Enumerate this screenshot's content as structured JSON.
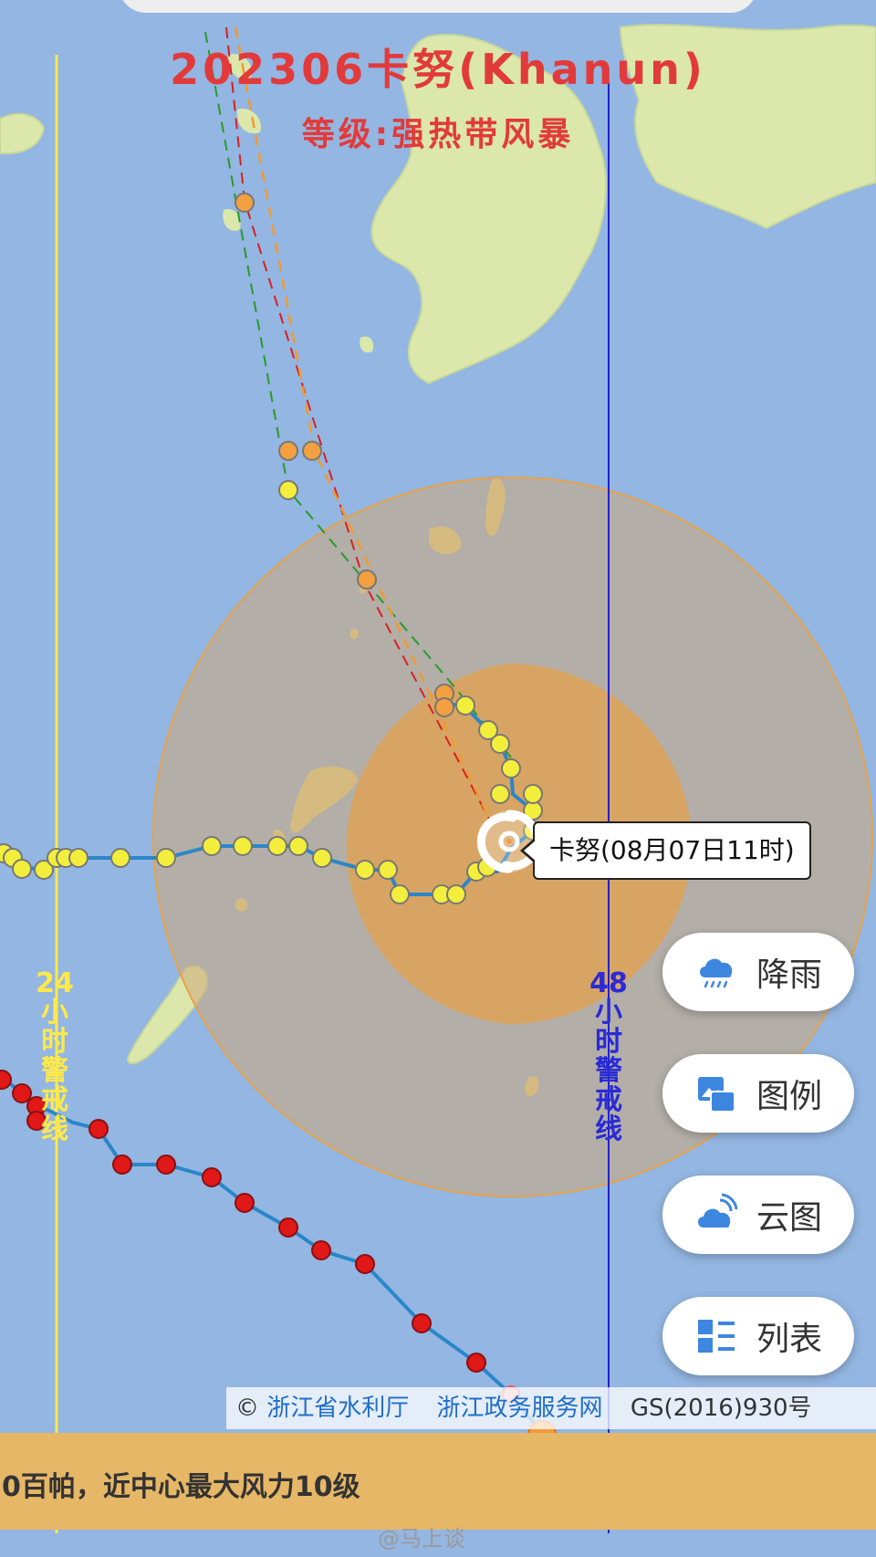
{
  "title": "202306卡努(Khanun)",
  "subtitle": "等级:强热带风暴",
  "warning_lines": {
    "line24": {
      "label": "24小时警戒线",
      "color": "#ffe94a"
    },
    "line48": {
      "label": "48小时警戒线",
      "color": "#2a2ad6"
    }
  },
  "typhoon_label": "卡努(08月07日11时)",
  "buttons": [
    {
      "label": "降雨",
      "icon": "rain-cloud-icon"
    },
    {
      "label": "图例",
      "icon": "legend-image-icon"
    },
    {
      "label": "云图",
      "icon": "satellite-cloud-icon"
    },
    {
      "label": "列表",
      "icon": "list-icon"
    }
  ],
  "attribution": {
    "copyright": "©",
    "source1": "浙江省水利厅",
    "source2": "浙江政务服务网",
    "license": "GS(2016)930号"
  },
  "info_text": "0百帕，近中心最大风力10级",
  "watermark": "@马上谈",
  "colors": {
    "sea": "#8fb4e0",
    "land": "#d9e6a8",
    "wind_circle_outer": "#b5ada4",
    "wind_circle_inner": "#e0a85a",
    "track_line": "#2a86c8",
    "tropical_storm_dot": "#f3ee3b",
    "forecast_dot": "#f0a040",
    "typhoon_dot": "#e01818"
  }
}
